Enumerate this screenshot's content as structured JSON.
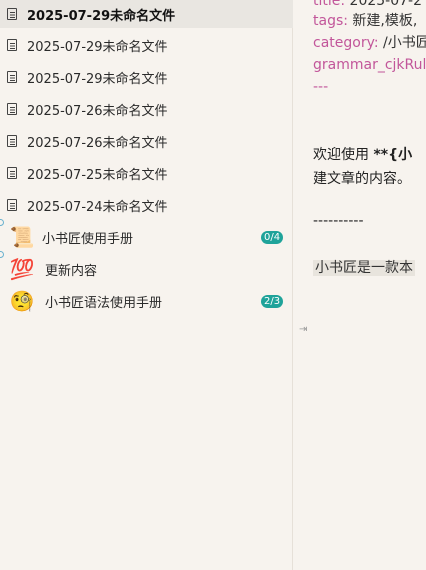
{
  "sidebar": {
    "files": [
      {
        "name": "2025-07-29未命名文件"
      },
      {
        "name": "2025-07-29未命名文件"
      },
      {
        "name": "2025-07-29未命名文件"
      },
      {
        "name": "2025-07-26未命名文件"
      },
      {
        "name": "2025-07-26未命名文件"
      },
      {
        "name": "2025-07-25未命名文件"
      },
      {
        "name": "2025-07-24未命名文件"
      }
    ],
    "books": [
      {
        "name": "小书匠使用手册",
        "icon": "scroll-emoji",
        "badge": "0/4"
      },
      {
        "name": "更新内容",
        "icon": "hundred-points-emoji",
        "badge": ""
      },
      {
        "name": "小书匠语法使用手册",
        "icon": "monocle-face-emoji",
        "badge": "2/3"
      }
    ],
    "accent_color": "#1fa39a"
  },
  "editor": {
    "front_matter": {
      "title_key": "title:",
      "title_val": "2025-07-2",
      "tags_key": "tags:",
      "tags_val": "新建,模板,",
      "category_key": "category:",
      "category_val": "/小书匠",
      "grammar_line": "grammar_cjkRul",
      "end_marker": "---"
    },
    "welcome_prefix": "欢迎使用",
    "welcome_bold": "**{小",
    "welcome_line2": "建文章的内容。",
    "hr_line": "----------",
    "intro_line": "小书匠是一款本"
  }
}
